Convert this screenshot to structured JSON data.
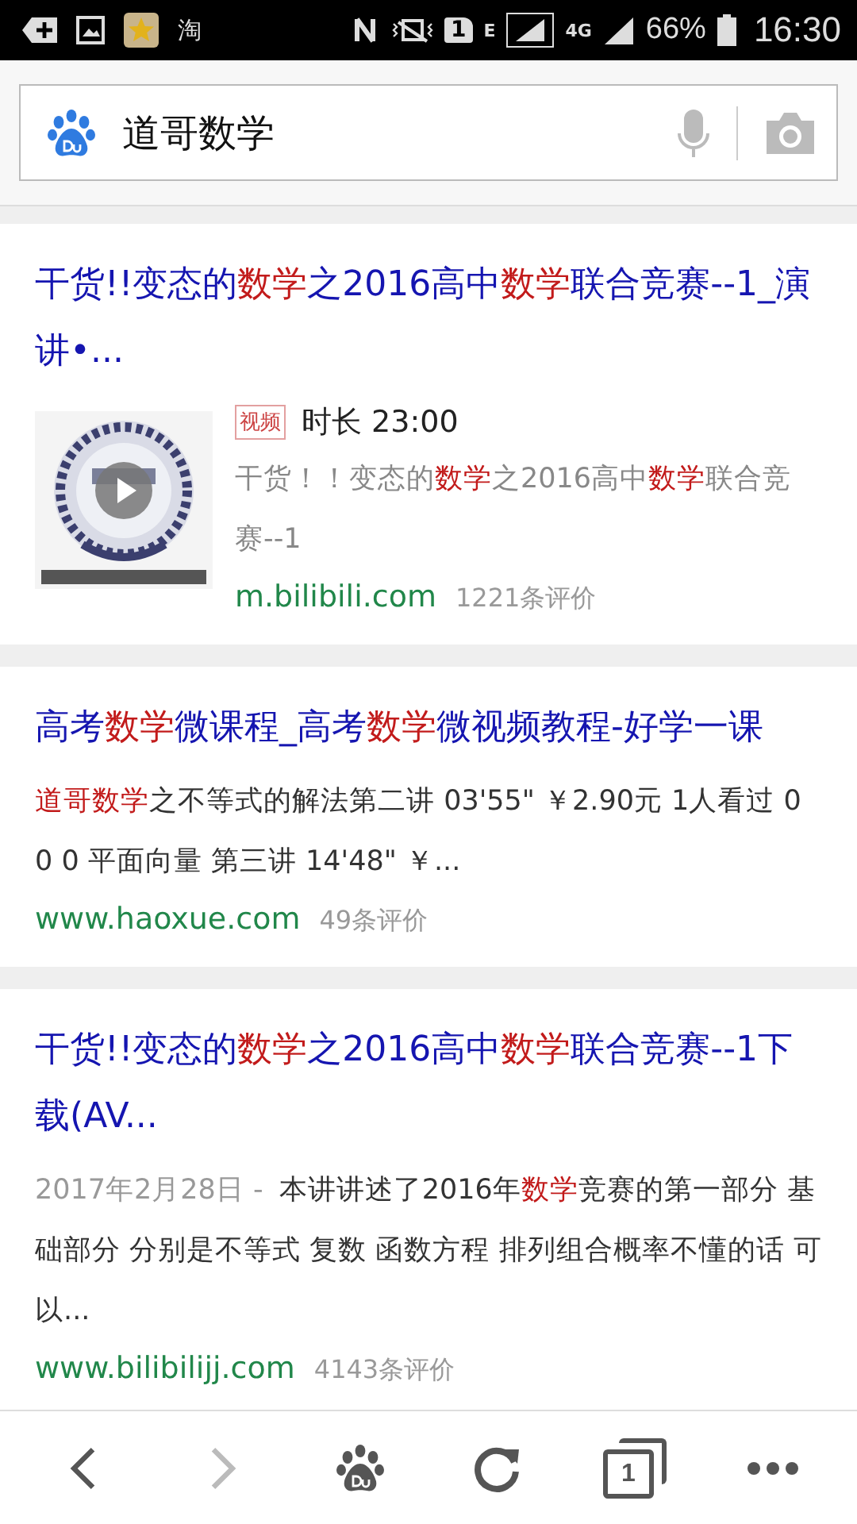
{
  "status_bar": {
    "app_label": "淘",
    "sim_label": "1",
    "network_type": "E",
    "data_type": "4G",
    "battery": "66%",
    "time": "16:30"
  },
  "search": {
    "value": "道哥数学"
  },
  "results": [
    {
      "kind": "video",
      "title": [
        {
          "text": "干货!!变态的",
          "highlight": false
        },
        {
          "text": "数学",
          "highlight": true
        },
        {
          "text": "之2016高中",
          "highlight": false
        },
        {
          "text": "数学",
          "highlight": true
        },
        {
          "text": "联合竞赛--1_演讲•...",
          "highlight": false
        }
      ],
      "tag": "视频",
      "duration": "时长 23:00",
      "snippet": [
        {
          "text": "干货！！变态的",
          "highlight": false
        },
        {
          "text": "数学",
          "highlight": true
        },
        {
          "text": "之2016高中",
          "highlight": false
        },
        {
          "text": "数学",
          "highlight": true
        },
        {
          "text": "联合竞赛--1",
          "highlight": false
        }
      ],
      "site": "m.bilibili.com",
      "reviews": "1221条评价"
    },
    {
      "kind": "text",
      "title": [
        {
          "text": "高考",
          "highlight": false
        },
        {
          "text": "数学",
          "highlight": true
        },
        {
          "text": "微课程_高考",
          "highlight": false
        },
        {
          "text": "数学",
          "highlight": true
        },
        {
          "text": "微视频教程-好学一课",
          "highlight": false
        }
      ],
      "snippet": [
        {
          "text": "道哥数学",
          "highlight": true
        },
        {
          "text": "之不等式的解法第二讲 03'55\" ￥2.90元 1人看过 0 0 0 平面向量 第三讲 14'48\" ￥...",
          "highlight": false
        }
      ],
      "site": "www.haoxue.com",
      "reviews": "49条评价"
    },
    {
      "kind": "text",
      "title": [
        {
          "text": "干货!!变态的",
          "highlight": false
        },
        {
          "text": "数学",
          "highlight": true
        },
        {
          "text": "之2016高中",
          "highlight": false
        },
        {
          "text": "数学",
          "highlight": true
        },
        {
          "text": "联合竞赛--1下载(AV...",
          "highlight": false
        }
      ],
      "date": "2017年2月28日 -",
      "snippet": [
        {
          "text": "本讲讲述了2016年",
          "highlight": false
        },
        {
          "text": "数学",
          "highlight": true
        },
        {
          "text": "竞赛的第一部分 基础部分 分别是不等式 复数 函数方程 排列组合概率不懂的话 可以...",
          "highlight": false
        }
      ],
      "site": "www.bilibilijj.com",
      "reviews": "4143条评价"
    }
  ],
  "toolbar": {
    "back_disabled": false,
    "forward_disabled": true,
    "tab_count": "1"
  }
}
